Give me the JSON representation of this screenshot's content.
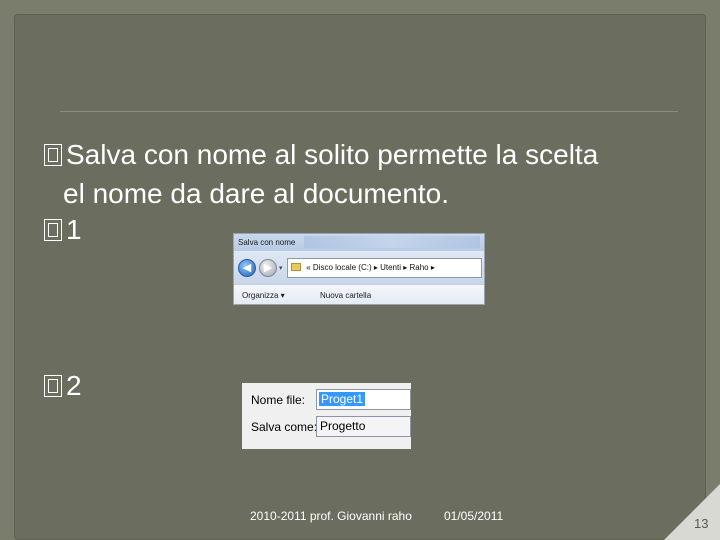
{
  "slide": {
    "bullets": [
      {
        "marker": "",
        "text": "Salva con nome al solito permette la scelta"
      },
      {
        "marker": "",
        "text": "1"
      },
      {
        "marker": "",
        "text": "2"
      }
    ],
    "continuation": "el nome da dare al documento."
  },
  "screenshot1": {
    "title": "Salva con nome",
    "address": {
      "prefix": "«",
      "path_1": "Disco locale (C:)",
      "sep": "▸",
      "path_2": "Utenti",
      "path_3": "Raho",
      "suffix": "▸"
    },
    "toolbar": {
      "organize": "Organizza ▾",
      "new_folder": "Nuova cartella"
    }
  },
  "screenshot2": {
    "file_name_label": "Nome file:",
    "file_name_value": "Proget1",
    "save_as_label": "Salva come:",
    "save_as_value": "Progetto"
  },
  "footer": {
    "left": "2010-2011 prof. Giovanni raho",
    "date": "01/05/2011",
    "page": "13"
  }
}
